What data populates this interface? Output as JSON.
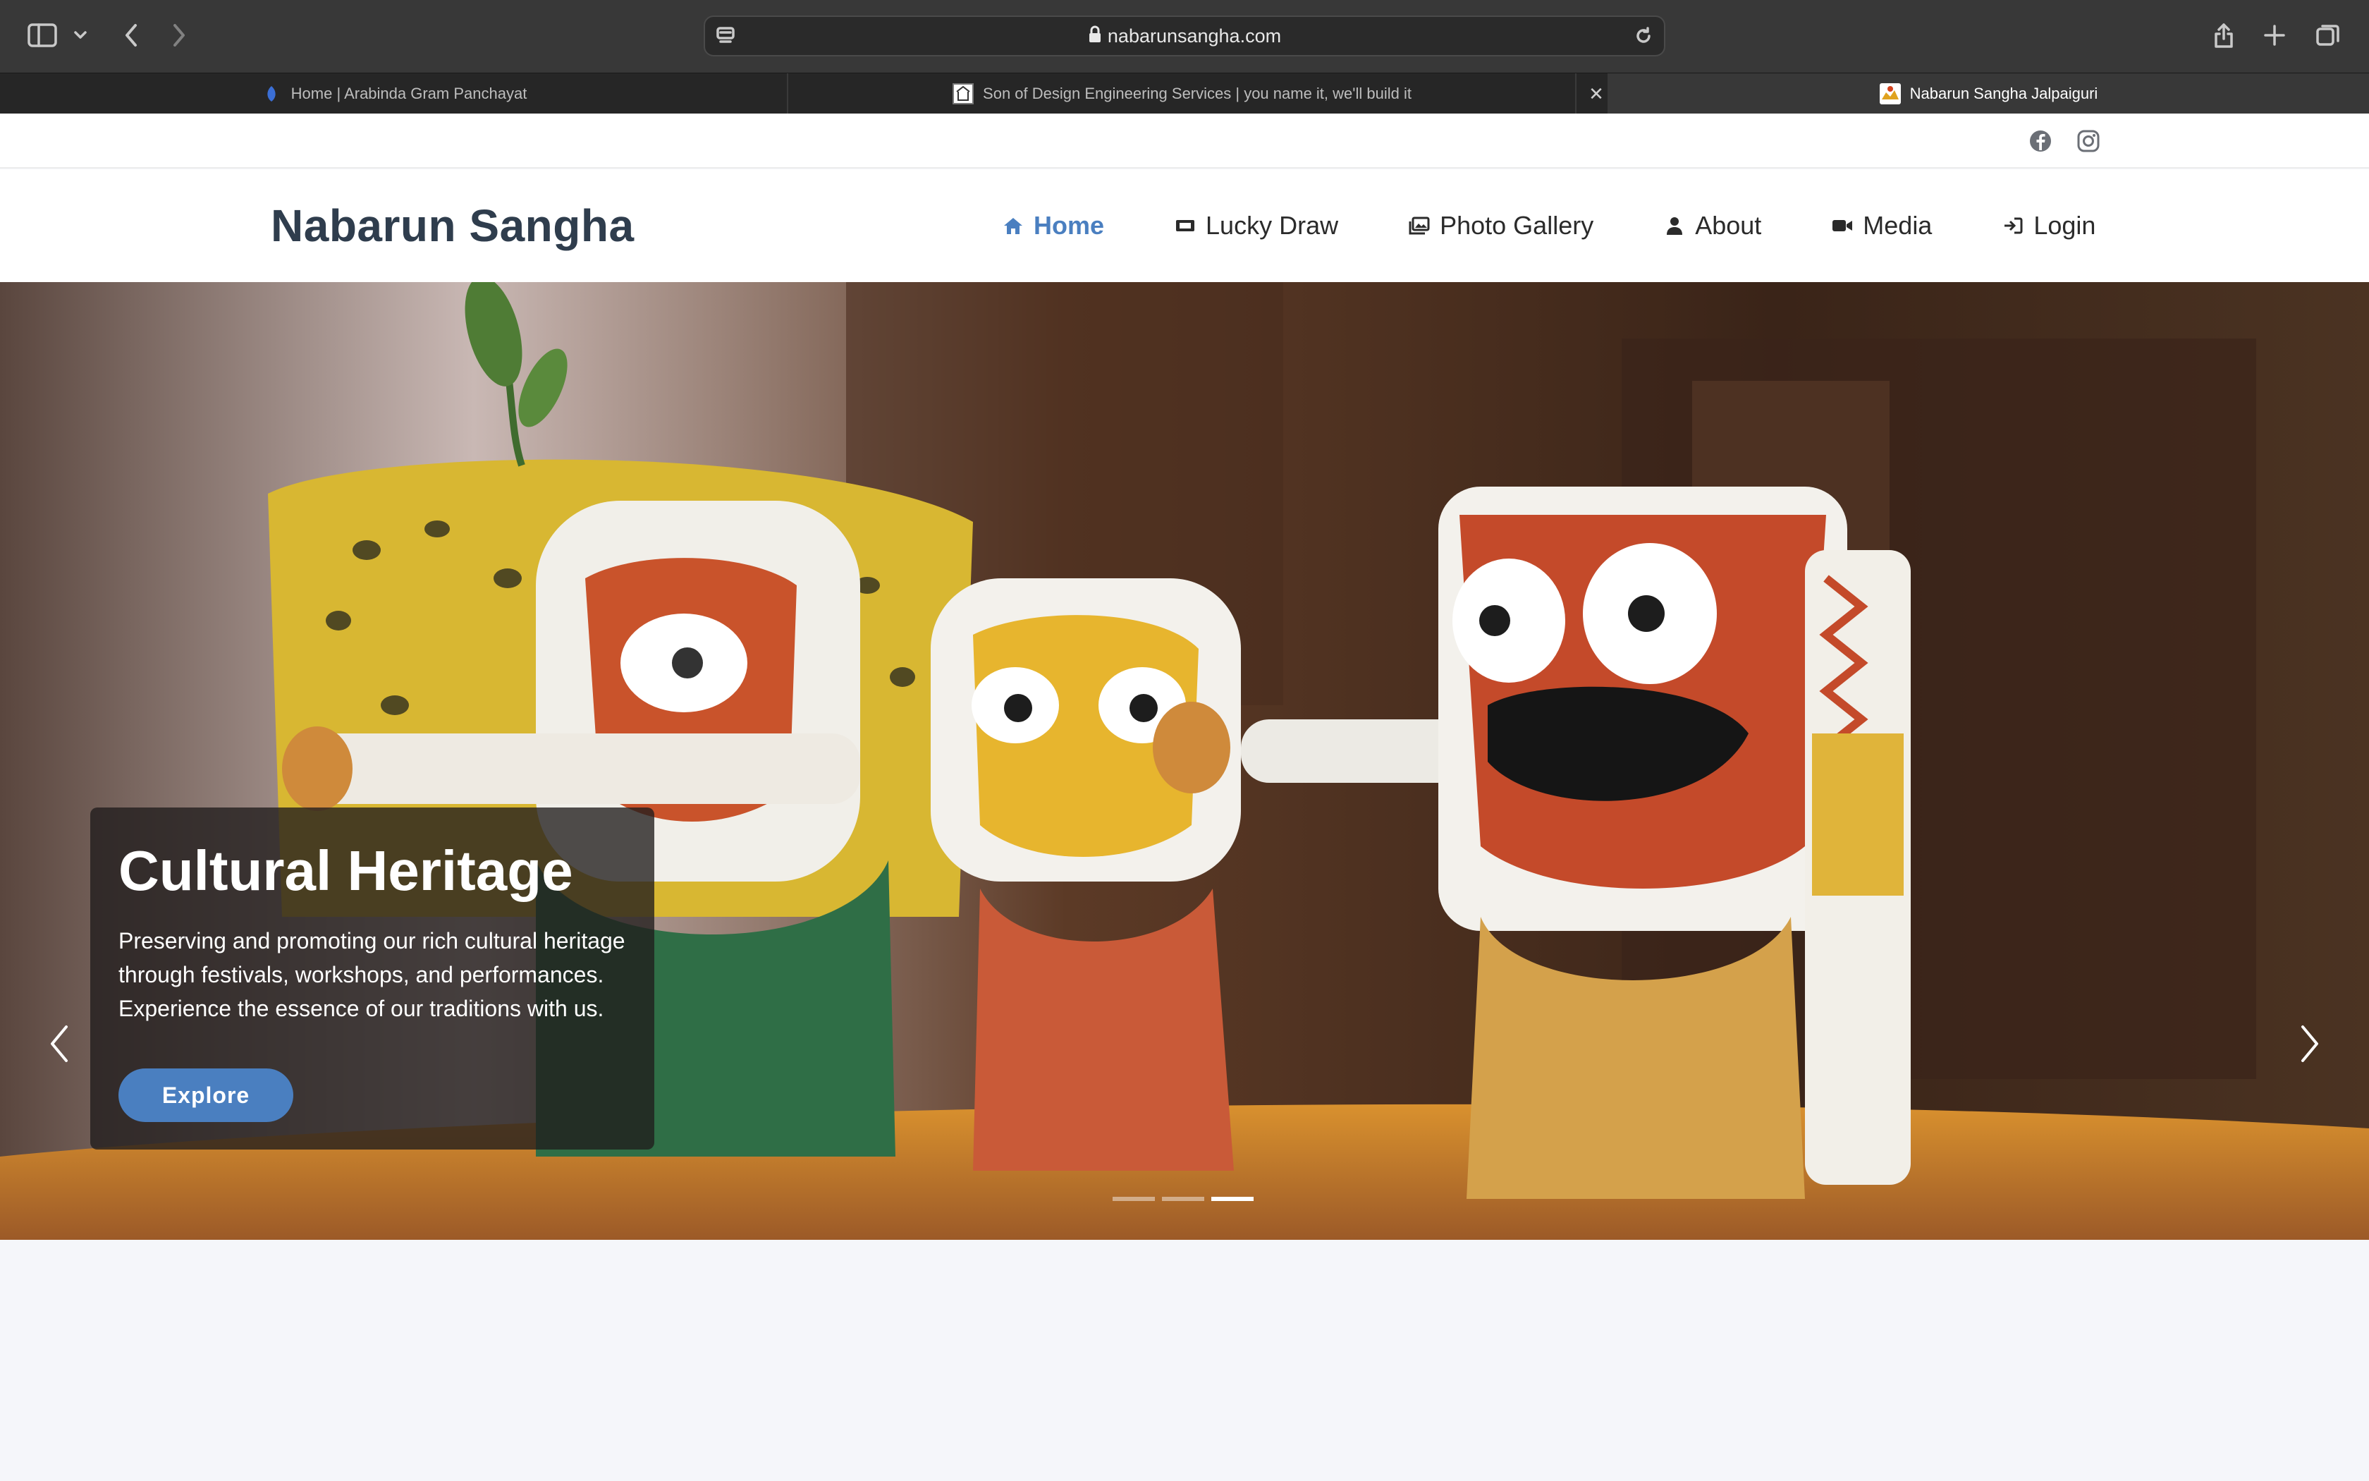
{
  "browser": {
    "url": "nabarunsangha.com",
    "tabs": [
      {
        "title": "Home | Arabinda Gram Panchayat",
        "active": false
      },
      {
        "title": "Son of Design Engineering Services | you name it, we'll build it",
        "active": false
      },
      {
        "title": "Nabarun Sangha Jalpaiguri",
        "active": true
      }
    ],
    "icons": [
      "sidebar-icon",
      "chevron-down-icon",
      "back-icon",
      "forward-icon",
      "reader-icon",
      "lock-icon",
      "reload-icon",
      "share-icon",
      "new-tab-icon",
      "tab-overview-icon",
      "close-icon"
    ]
  },
  "site": {
    "social": [
      "facebook-icon",
      "instagram-icon"
    ],
    "brand": "Nabarun Sangha",
    "nav": [
      {
        "label": "Home",
        "icon": "home-icon",
        "active": true
      },
      {
        "label": "Lucky Draw",
        "icon": "ticket-icon",
        "active": false
      },
      {
        "label": "Photo Gallery",
        "icon": "images-icon",
        "active": false
      },
      {
        "label": "About",
        "icon": "user-icon",
        "active": false
      },
      {
        "label": "Media",
        "icon": "video-icon",
        "active": false
      },
      {
        "label": "Login",
        "icon": "login-icon",
        "active": false
      }
    ],
    "accent_color": "#4a7fc0",
    "brand_color": "#2f3d4d"
  },
  "hero": {
    "title": "Cultural Heritage",
    "description": "Preserving and promoting our rich cultural heritage through festivals, workshops, and performances. Experience the essence of our traditions with us.",
    "button_label": "Explore",
    "slide_count": 3,
    "active_slide": 3
  }
}
